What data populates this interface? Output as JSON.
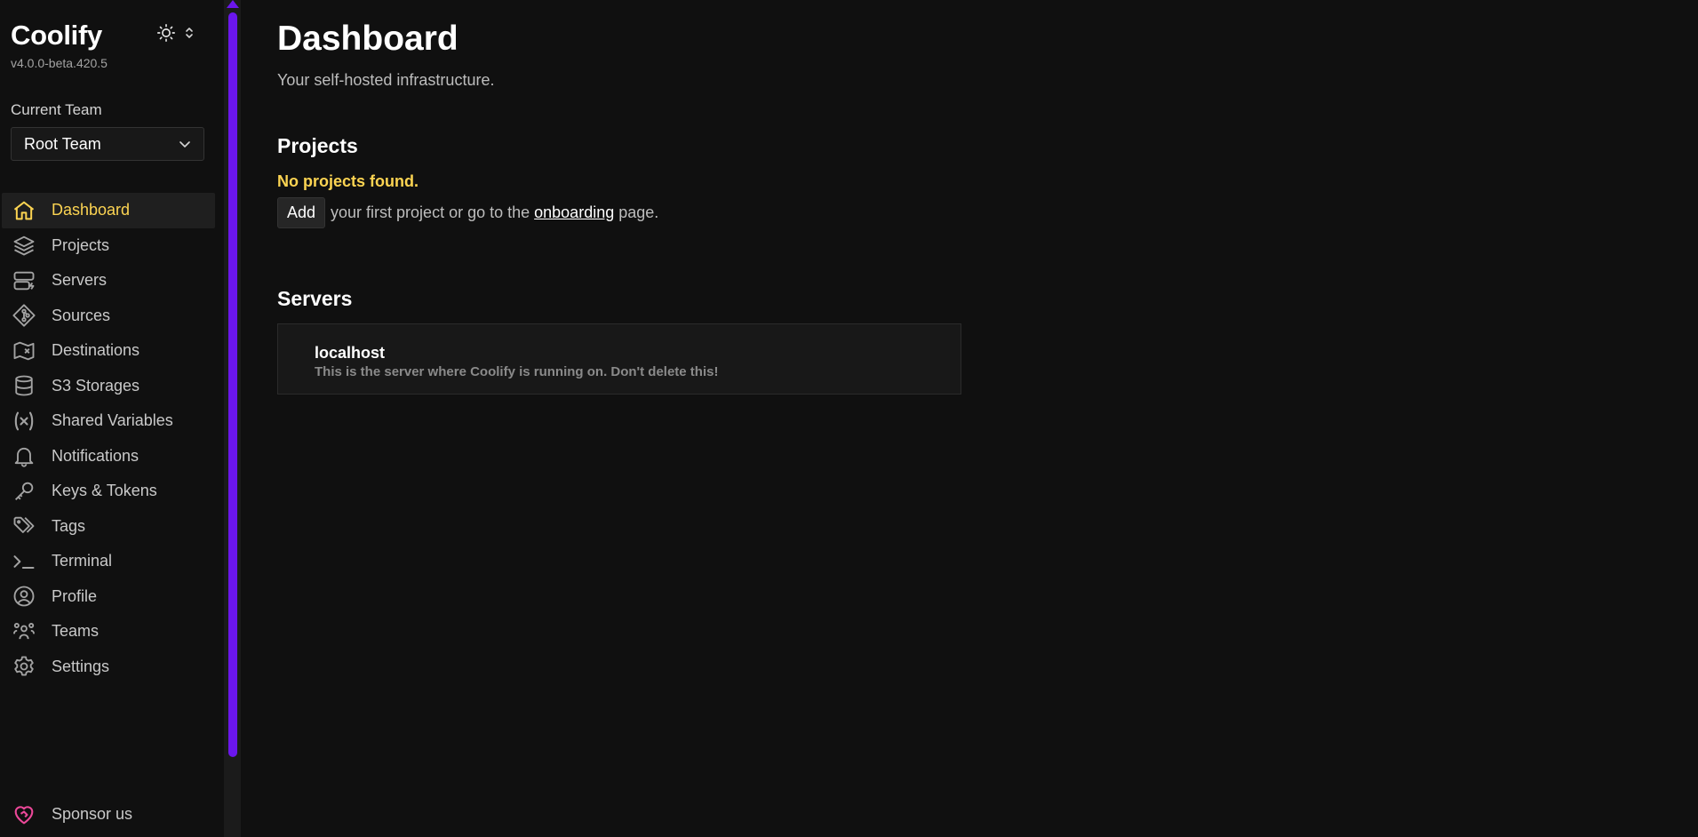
{
  "app": {
    "name": "Coolify",
    "version": "v4.0.0-beta.420.5"
  },
  "team": {
    "label": "Current Team",
    "selected": "Root Team"
  },
  "nav": [
    {
      "label": "Dashboard",
      "icon": "home-icon",
      "active": true
    },
    {
      "label": "Projects",
      "icon": "layers-icon"
    },
    {
      "label": "Servers",
      "icon": "server-icon"
    },
    {
      "label": "Sources",
      "icon": "git-branch-icon"
    },
    {
      "label": "Destinations",
      "icon": "map-icon"
    },
    {
      "label": "S3 Storages",
      "icon": "database-icon"
    },
    {
      "label": "Shared Variables",
      "icon": "variable-icon"
    },
    {
      "label": "Notifications",
      "icon": "bell-icon"
    },
    {
      "label": "Keys & Tokens",
      "icon": "key-icon"
    },
    {
      "label": "Tags",
      "icon": "tag-icon"
    },
    {
      "label": "Terminal",
      "icon": "terminal-icon"
    },
    {
      "label": "Profile",
      "icon": "user-circle-icon"
    },
    {
      "label": "Teams",
      "icon": "users-icon"
    },
    {
      "label": "Settings",
      "icon": "gear-icon"
    }
  ],
  "sponsor": {
    "label": "Sponsor us",
    "icon": "heart-handshake-icon"
  },
  "main": {
    "title": "Dashboard",
    "subtitle": "Your self-hosted infrastructure.",
    "projects": {
      "heading": "Projects",
      "empty": "No projects found.",
      "add_button": "Add",
      "text_before": "your first project or go to the",
      "link": "onboarding",
      "text_after": "page."
    },
    "servers": {
      "heading": "Servers",
      "items": [
        {
          "name": "localhost",
          "description": "This is the server where Coolify is running on. Don't delete this!"
        }
      ]
    }
  },
  "colors": {
    "accent": "#fcd452",
    "scrollbar": "#6b16ed",
    "background": "#101010",
    "sponsor": "#ec4899"
  }
}
